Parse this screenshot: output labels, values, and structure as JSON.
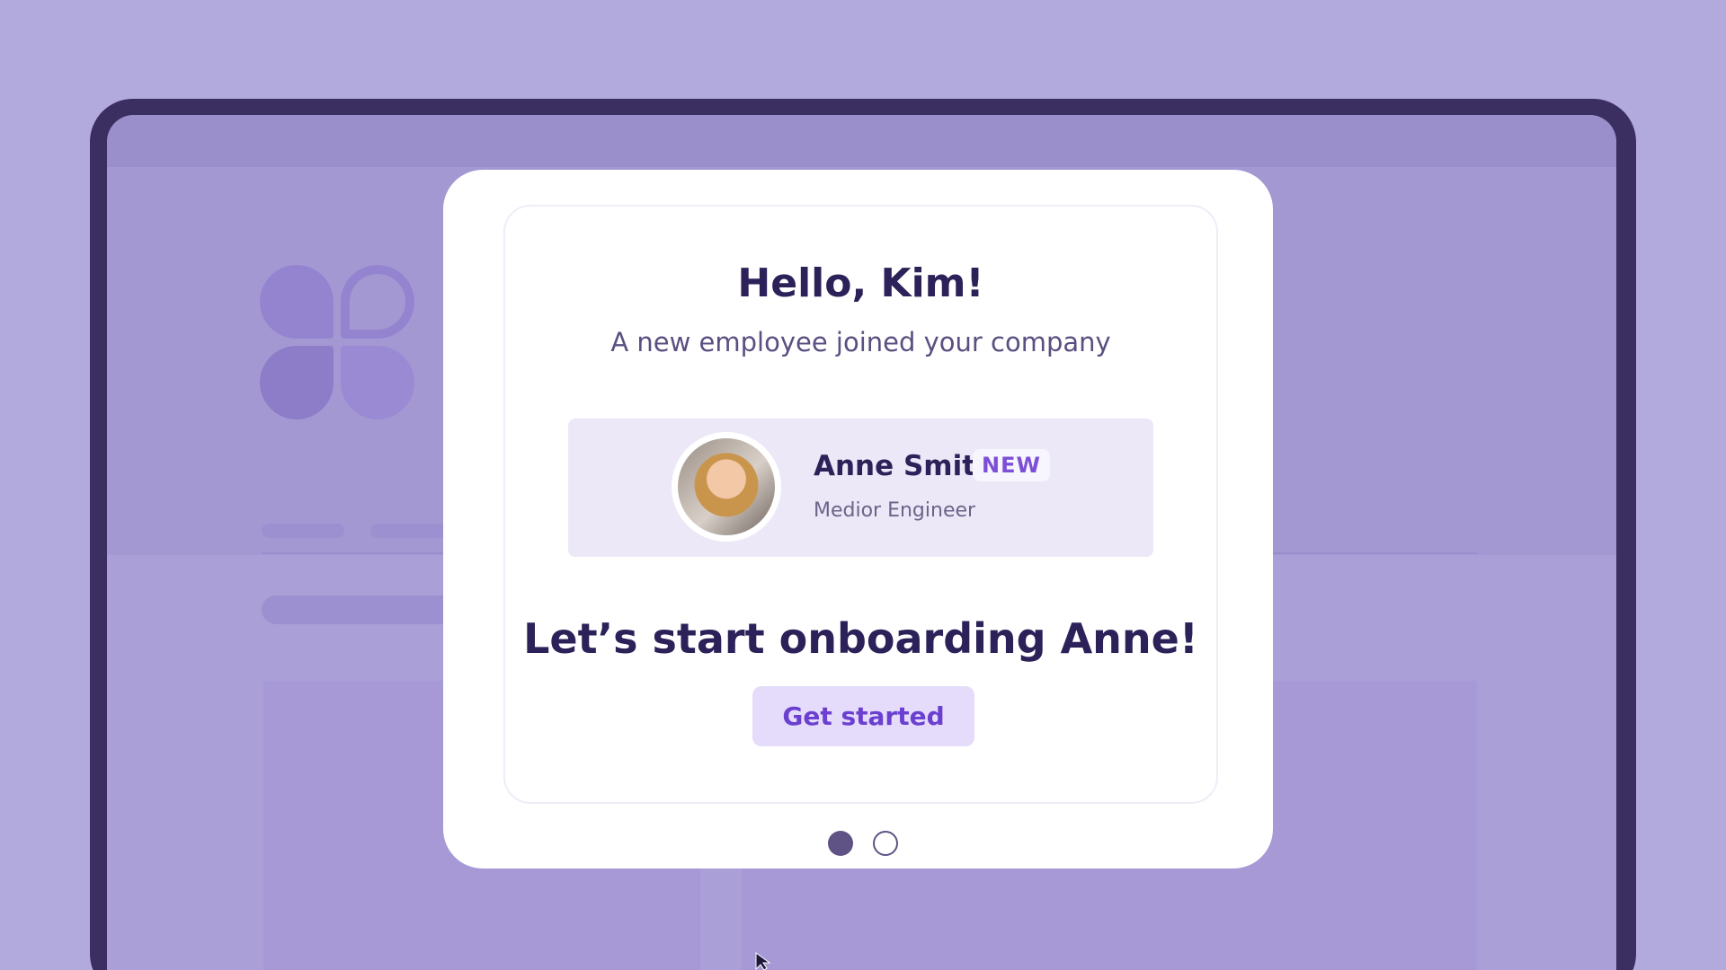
{
  "colors": {
    "page_background": "#b2a9dc",
    "device_frame": "#3b2f62",
    "screen": "#ab9fd8",
    "accent": "#6b3fd0",
    "heading": "#2c2158"
  },
  "background_app": {
    "logo_icon": "clover-logo-icon"
  },
  "modal": {
    "greeting": "Hello, Kim!",
    "subtitle": "A new employee joined your company",
    "employee": {
      "name": "Anne Smith",
      "badge": "NEW",
      "role": "Medior Engineer",
      "avatar_icon": "profile-photo"
    },
    "cta_heading": "Let’s start onboarding Anne!",
    "button_label": "Get started",
    "pagination": {
      "current_page": 1,
      "total_pages": 2
    }
  }
}
